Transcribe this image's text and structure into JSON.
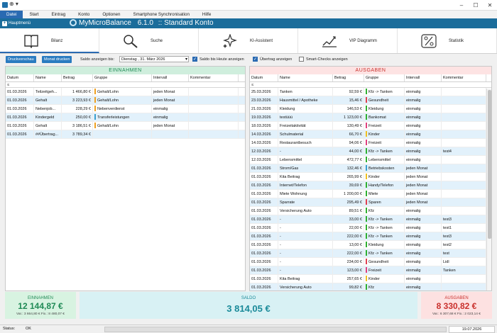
{
  "titlebar": {
    "quick_access": "⊕ ▾"
  },
  "menu": [
    "Datei",
    "Start",
    "Eintrag",
    "Konto",
    "Optionen",
    "Smartphone Synchronisation",
    "Hilfe"
  ],
  "header": {
    "hauptmenu": "Hauptmenü",
    "logo_text": "MyMicroBalance",
    "version": "6.1.0",
    "konto": ":: Standard Konto"
  },
  "toolbar": [
    {
      "label": "Bilanz",
      "icon": "book-icon"
    },
    {
      "label": "Suche",
      "icon": "magnifier-icon"
    },
    {
      "label": "KI-Assistent",
      "icon": "sparkle-icon"
    },
    {
      "label": "VIP Diagramm",
      "icon": "chart-icon"
    },
    {
      "label": "Statistik",
      "icon": "percent-icon"
    }
  ],
  "options": {
    "druckvorschau": "Druckvorschau",
    "monat_drucken": "Monat drucken",
    "saldo_label": "Saldo anzeigen bis:",
    "date_value": "Dienstag ,  31.     März     2026",
    "saldo_heute": "Saldo bis Heute anzeigen",
    "uebertrag": "Übertrag anzeigen",
    "smart_checks": "Smart-Checks anzeigen"
  },
  "einnahmen": {
    "title": "EINNAHMEN",
    "columns": [
      "Datum",
      "Name",
      "Betrag",
      "Gruppe",
      "Intervall",
      "Kommentar"
    ],
    "filter": "≤",
    "rows": [
      {
        "datum": "01.03.2026",
        "name": "Teilzeitgeh...",
        "betrag": "1 466,80 €",
        "gruppe": "Gehalt/Lohn",
        "color": "#f0a020",
        "intervall": "jeden Monat",
        "kommentar": ""
      },
      {
        "datum": "01.03.2026",
        "name": "Gehalt",
        "betrag": "3 223,93 €",
        "gruppe": "Gehalt/Lohn",
        "color": "#f0a020",
        "intervall": "jeden Monat",
        "kommentar": ""
      },
      {
        "datum": "01.03.2026",
        "name": "Nebenjob...",
        "betrag": "228,29 €",
        "gruppe": "Nebenverdienst",
        "color": "#f0a020",
        "intervall": "einmalig",
        "kommentar": ""
      },
      {
        "datum": "01.03.2026",
        "name": "Kindergeld",
        "betrag": "250,00 €",
        "gruppe": "Transferleistungen",
        "color": "#3aa0d0",
        "intervall": "einmalig",
        "kommentar": ""
      },
      {
        "datum": "01.03.2026",
        "name": "Gehalt",
        "betrag": "3 186,51 €",
        "gruppe": "Gehalt/Lohn",
        "color": "#f0a020",
        "intervall": "jeden Monat",
        "kommentar": ""
      },
      {
        "datum": "01.03.2026",
        "name": "##Übertrag...",
        "betrag": "3 789,34 €",
        "gruppe": "",
        "color": "",
        "intervall": "",
        "kommentar": ""
      }
    ]
  },
  "ausgaben": {
    "title": "AUSGABEN",
    "columns": [
      "Datum",
      "Name",
      "Betrag",
      "Gruppe",
      "Intervall",
      "Kommentar"
    ],
    "filter": "≤",
    "rows": [
      {
        "datum": "25.03.2026",
        "name": "Tanken",
        "betrag": "92,59 €",
        "gruppe": "Kfz -> Tanken",
        "color": "#30b030",
        "intervall": "einmalig",
        "kommentar": ""
      },
      {
        "datum": "23.03.2026",
        "name": "Hausmittel / Apotheke",
        "betrag": "15,46 €",
        "gruppe": "Gesundheit",
        "color": "#e04050",
        "intervall": "einmalig",
        "kommentar": ""
      },
      {
        "datum": "21.03.2026",
        "name": "Kleidung",
        "betrag": "146,53 €",
        "gruppe": "Kleidung",
        "color": "#30b030",
        "intervall": "einmalig",
        "kommentar": ""
      },
      {
        "datum": "19.03.2026",
        "name": "testüüü",
        "betrag": "1 123,00 €",
        "gruppe": "Bankomat",
        "color": "#30b030",
        "intervall": "einmalig",
        "kommentar": ""
      },
      {
        "datum": "18.03.2026",
        "name": "Freizeitaktivität",
        "betrag": "130,49 €",
        "gruppe": "Freizeit",
        "color": "#e04080",
        "intervall": "einmalig",
        "kommentar": ""
      },
      {
        "datum": "14.03.2026",
        "name": "Schulmaterial",
        "betrag": "66,70 €",
        "gruppe": "Kinder",
        "color": "#f0c020",
        "intervall": "einmalig",
        "kommentar": ""
      },
      {
        "datum": "14.03.2026",
        "name": "Restaurantbesuch",
        "betrag": "94,06 €",
        "gruppe": "Freizeit",
        "color": "#e04080",
        "intervall": "einmalig",
        "kommentar": ""
      },
      {
        "datum": "12.03.2026",
        "name": "-",
        "betrag": "44,00 €",
        "gruppe": "Kfz -> Tanken",
        "color": "#30b030",
        "intervall": "einmalig",
        "kommentar": "test4"
      },
      {
        "datum": "12.03.2026",
        "name": "Lebensmittel",
        "betrag": "472,77 €",
        "gruppe": "Lebensmittel",
        "color": "#30b030",
        "intervall": "einmalig",
        "kommentar": ""
      },
      {
        "datum": "01.03.2026",
        "name": "Strom/Gas",
        "betrag": "132,46 €",
        "gruppe": "Betriebskosten",
        "color": "#3aa0d0",
        "intervall": "jeden Monat",
        "kommentar": ""
      },
      {
        "datum": "01.03.2026",
        "name": "Kita Beitrag",
        "betrag": "265,99 €",
        "gruppe": "Kinder",
        "color": "#f0c020",
        "intervall": "jeden Monat",
        "kommentar": ""
      },
      {
        "datum": "01.03.2026",
        "name": "Internet/Telefon",
        "betrag": "39,69 €",
        "gruppe": "Handy/Telefon",
        "color": "#30b030",
        "intervall": "jeden Monat",
        "kommentar": ""
      },
      {
        "datum": "01.03.2026",
        "name": "Miete Wohnung",
        "betrag": "1 200,00 €",
        "gruppe": "Miete",
        "color": "#30b030",
        "intervall": "jeden Monat",
        "kommentar": ""
      },
      {
        "datum": "01.03.2026",
        "name": "Sparrate",
        "betrag": "295,49 €",
        "gruppe": "Sparen",
        "color": "#e04050",
        "intervall": "jeden Monat",
        "kommentar": ""
      },
      {
        "datum": "01.03.2026",
        "name": "Versicherung Auto",
        "betrag": "89,51 €",
        "gruppe": "Kfz",
        "color": "#30b030",
        "intervall": "einmalig",
        "kommentar": ""
      },
      {
        "datum": "01.03.2026",
        "name": "-",
        "betrag": "33,00 €",
        "gruppe": "Kfz -> Tanken",
        "color": "#30b030",
        "intervall": "einmalig",
        "kommentar": "test3"
      },
      {
        "datum": "01.03.2026",
        "name": "-",
        "betrag": "22,00 €",
        "gruppe": "Kfz -> Tanken",
        "color": "#30b030",
        "intervall": "einmalig",
        "kommentar": "test1"
      },
      {
        "datum": "01.03.2026",
        "name": "-",
        "betrag": "222,00 €",
        "gruppe": "Kfz -> Tanken",
        "color": "#30b030",
        "intervall": "einmalig",
        "kommentar": "test3"
      },
      {
        "datum": "01.03.2026",
        "name": "-",
        "betrag": "13,00 €",
        "gruppe": "Kleidung",
        "color": "#30b030",
        "intervall": "einmalig",
        "kommentar": "test2"
      },
      {
        "datum": "01.03.2026",
        "name": "-",
        "betrag": "222,00 €",
        "gruppe": "Kfz -> Tanken",
        "color": "#30b030",
        "intervall": "einmalig",
        "kommentar": "test"
      },
      {
        "datum": "01.03.2026",
        "name": "-",
        "betrag": "234,00 €",
        "gruppe": "Gesundheit",
        "color": "#e04050",
        "intervall": "einmalig",
        "kommentar": "Lidl"
      },
      {
        "datum": "01.03.2026",
        "name": "-",
        "betrag": "123,00 €",
        "gruppe": "Freizeit",
        "color": "#e04080",
        "intervall": "einmalig",
        "kommentar": "Tanken"
      },
      {
        "datum": "01.03.2026",
        "name": "Kita Beitrag",
        "betrag": "257,65 €",
        "gruppe": "Kinder",
        "color": "#f0c020",
        "intervall": "einmalig",
        "kommentar": ""
      },
      {
        "datum": "01.03.2026",
        "name": "Versicherung Auto",
        "betrag": "99,82 €",
        "gruppe": "Kfz",
        "color": "#30b030",
        "intervall": "einmalig",
        "kommentar": ""
      }
    ]
  },
  "summary": {
    "einnahmen": {
      "title": "EINNAHMEN",
      "value": "12 144,87 €",
      "sub": "Var.: 3 664,80 €   Fix.: 8 480,07 €"
    },
    "saldo": {
      "title": "SALDO",
      "value": "3 814,05 €"
    },
    "ausgaben": {
      "title": "AUSGABEN",
      "value": "8 330,82 €",
      "sub": "Var.: 6 307,68 €   Fix.: 2 023,14 €"
    }
  },
  "status": {
    "label": "Status:",
    "value": "OK",
    "date": "19.07.2026"
  },
  "colors": {
    "header": "#1b6d9b",
    "einnahmen_head": "#cfeedd",
    "ausgaben_head": "#fde3e3",
    "einnahmen_text": "#1f8a55",
    "ausgaben_text": "#c9302c",
    "saldo_bg": "#d8f1f4"
  }
}
